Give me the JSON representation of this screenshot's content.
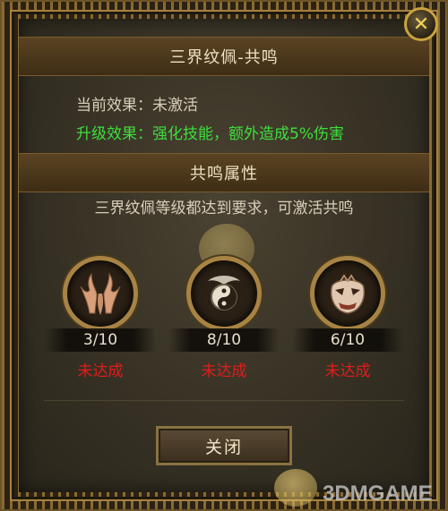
{
  "dialog": {
    "title": "三界纹佩-共鸣",
    "current_effect": "当前效果：未激活",
    "upgrade_effect": "升级效果：强化技能，额外造成5%伤害",
    "section_title": "共鸣属性",
    "requirement": "三界纹佩等级都达到要求，可激活共鸣",
    "close_label": "关闭",
    "close_icon": "✕"
  },
  "pendants": [
    {
      "icon": "antler-emblem-icon",
      "progress": "3/10",
      "status": "未达成"
    },
    {
      "icon": "taiji-emblem-icon",
      "progress": "8/10",
      "status": "未达成"
    },
    {
      "icon": "demon-mask-emblem-icon",
      "progress": "6/10",
      "status": "未达成"
    }
  ],
  "watermark": "3DMGAME",
  "colors": {
    "gold": "#c9a33d",
    "green_text": "#3ddf3d",
    "red_text": "#e21c1c",
    "panel": "#353023"
  }
}
